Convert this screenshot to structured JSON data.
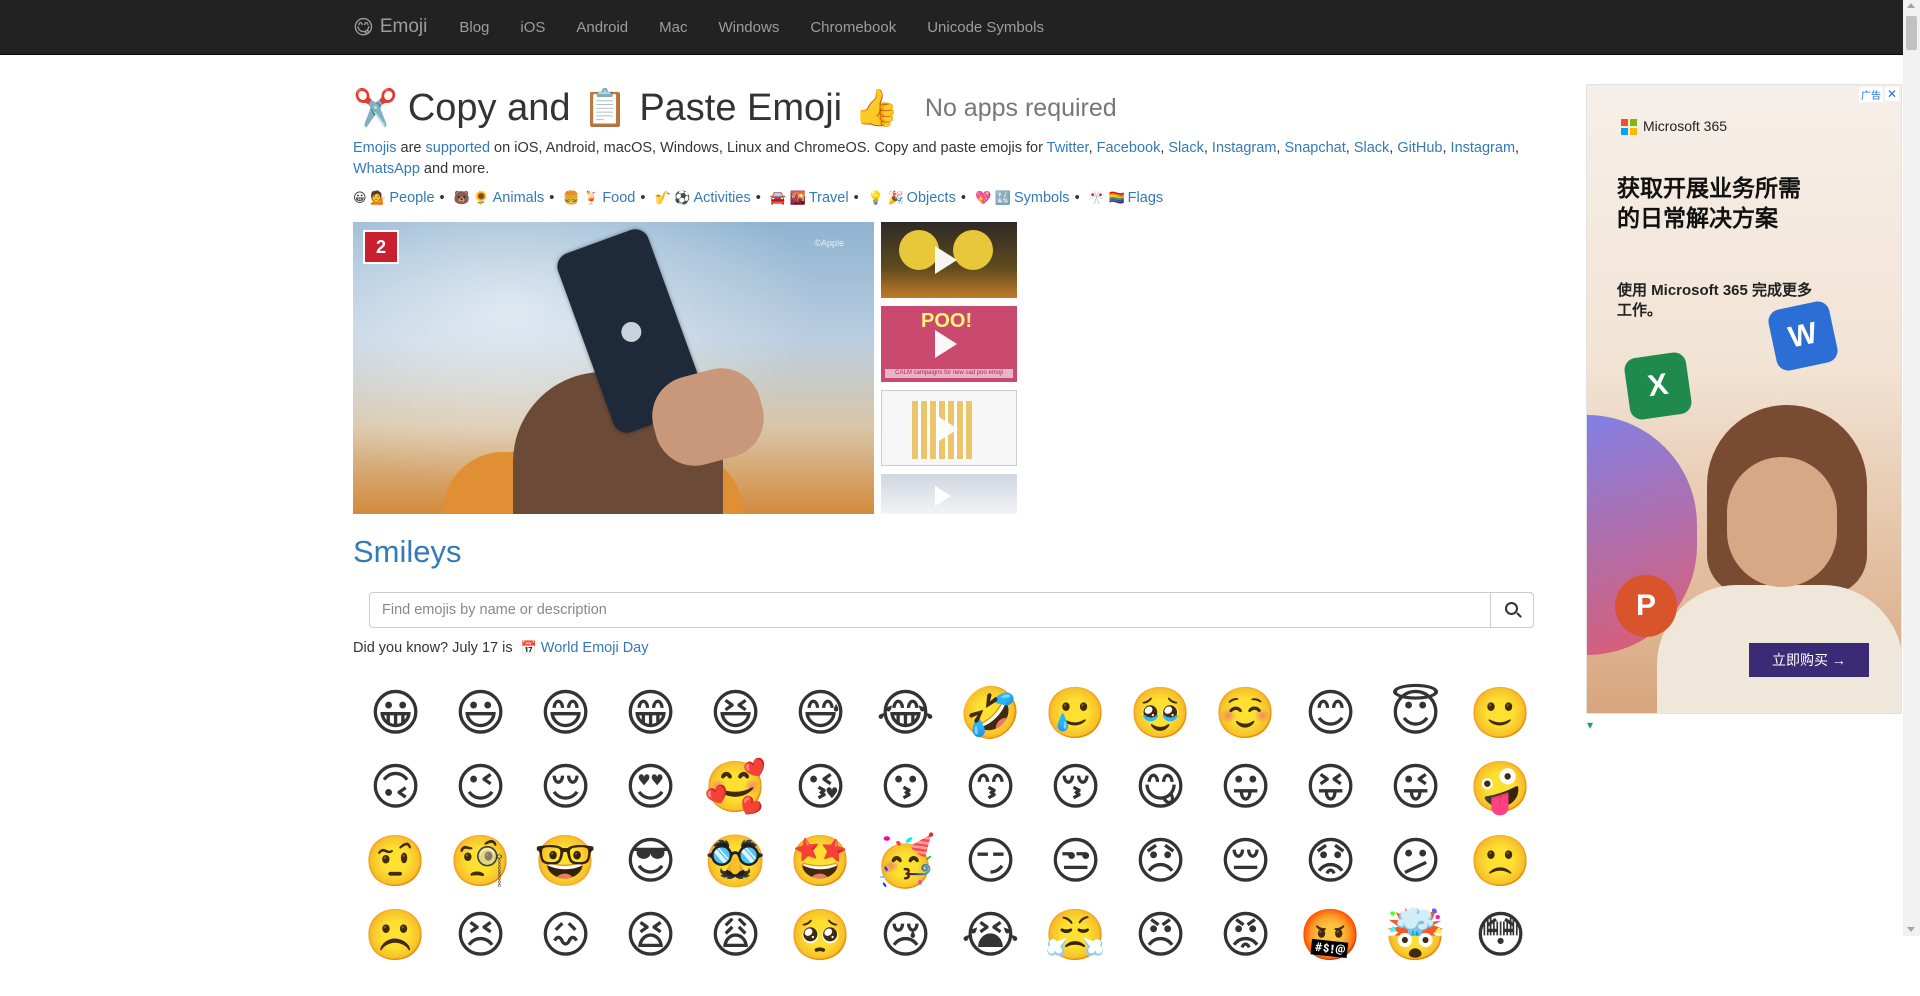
{
  "nav": {
    "brand_icon": "😋",
    "brand": "Emoji",
    "links": [
      "Blog",
      "iOS",
      "Android",
      "Mac",
      "Windows",
      "Chromebook",
      "Unicode Symbols"
    ]
  },
  "header": {
    "icon1": "✂️",
    "copy": "Copy and",
    "icon2": "📋",
    "paste": "Paste Emoji",
    "icon3": "👍",
    "tagline": "No apps required"
  },
  "intro": {
    "emojis_link": "Emojis",
    "are": " are ",
    "supported_link": "supported",
    "text1": " on iOS, Android, macOS, Windows, Linux and ChromeOS. Copy and paste emojis for ",
    "platform_links": [
      "Twitter",
      "Facebook",
      "Slack",
      "Instagram",
      "Snapchat",
      "Slack",
      "GitHub",
      "Instagram",
      "WhatsApp"
    ],
    "text2": " and more."
  },
  "categories": [
    {
      "icons": "😀 💁",
      "label": "People"
    },
    {
      "icons": "🐻 🌻",
      "label": "Animals"
    },
    {
      "icons": "🍔 🍹",
      "label": "Food"
    },
    {
      "icons": "🎷 ⚽",
      "label": "Activities"
    },
    {
      "icons": "🚘 🌇",
      "label": "Travel"
    },
    {
      "icons": "💡 🎉",
      "label": "Objects"
    },
    {
      "icons": "💖 🔣",
      "label": "Symbols"
    },
    {
      "icons": "🎌 🏳️‍🌈",
      "label": "Flags"
    }
  ],
  "video": {
    "logo": "2",
    "watermark": "©Apple",
    "thumb2_title": "POO!",
    "thumb2_caption": "CALM campaigns for new sad poo emoji"
  },
  "section_title": "Smileys",
  "search": {
    "placeholder": "Find emojis by name or description",
    "button_icon": "search-icon"
  },
  "did_you_know": {
    "text": "Did you know? July 17 is",
    "icon": "📅",
    "link": "World Emoji Day"
  },
  "emojis": [
    "😀",
    "😃",
    "😄",
    "😁",
    "😆",
    "😅",
    "😂",
    "🤣",
    "🥲",
    "🥹",
    "☺️",
    "😊",
    "😇",
    "🙂",
    "🙃",
    "😉",
    "😌",
    "😍",
    "🥰",
    "😘",
    "😗",
    "😙",
    "😚",
    "😋",
    "😛",
    "😝",
    "😜",
    "🤪",
    "🤨",
    "🧐",
    "🤓",
    "😎",
    "🥸",
    "🤩",
    "🥳",
    "😏",
    "😒",
    "😞",
    "😔",
    "😟",
    "😕",
    "🙁",
    "☹️",
    "😣",
    "😖",
    "😫",
    "😩",
    "🥺",
    "😢",
    "😭",
    "😤",
    "😠",
    "😡",
    "🤬",
    "🤯",
    "😳"
  ],
  "ad": {
    "brand": "Microsoft 365",
    "headline": "获取开展业务所需的日常解决方案",
    "sub": "使用 Microsoft 365 完成更多工作。",
    "cta": "立即购买 →",
    "tag": "广告",
    "close": "✕",
    "app_w": "W",
    "app_x": "X",
    "app_p": "P",
    "colors": {
      "word": "#2b6fd6",
      "excel": "#1f8a4c",
      "powerpoint": "#d9532b",
      "cta": "#3b2a75"
    }
  },
  "theme": {
    "link": "#337ab7",
    "navbar": "#222222",
    "nav_text": "#9d9d9d"
  }
}
